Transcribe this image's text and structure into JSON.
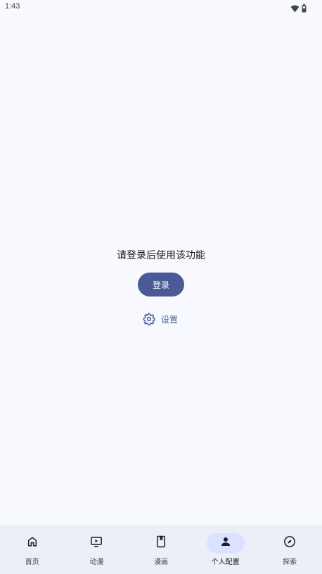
{
  "status_bar": {
    "time": "1:43",
    "icons": [
      "wifi-icon",
      "battery-icon"
    ]
  },
  "main": {
    "login_prompt": "请登录后使用该功能",
    "login_button": "登录",
    "settings_label": "设置",
    "settings_icon": "gear-icon"
  },
  "bottom_nav": {
    "items": [
      {
        "label": "首页",
        "icon": "home-icon",
        "active": false
      },
      {
        "label": "动漫",
        "icon": "tv-play-icon",
        "active": false
      },
      {
        "label": "漫画",
        "icon": "book-icon",
        "active": false
      },
      {
        "label": "个人配置",
        "icon": "person-icon",
        "active": true
      },
      {
        "label": "探索",
        "icon": "compass-icon",
        "active": false
      }
    ]
  },
  "colors": {
    "accent": "#4a5a96",
    "background": "#f8f9fe",
    "nav_background": "#eceef8",
    "nav_active_indicator": "#dce1ff"
  }
}
